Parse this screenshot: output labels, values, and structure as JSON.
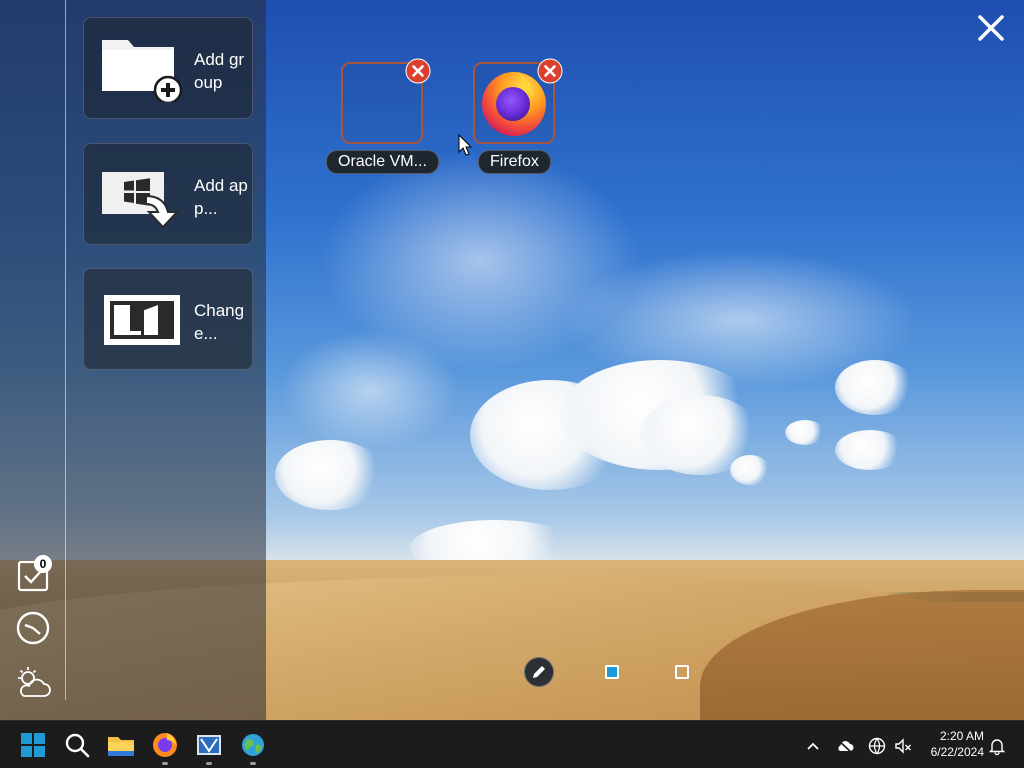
{
  "side_panel": {
    "tiles": [
      {
        "name": "add-group",
        "label": "Add group",
        "icon": "folder-plus-icon"
      },
      {
        "name": "add-app",
        "label": "Add app...",
        "icon": "windows-import-icon"
      },
      {
        "name": "change",
        "label": "Change...",
        "icon": "book-icon"
      }
    ],
    "todo_count": "0",
    "side_icons": [
      "checklist-icon",
      "clock-icon",
      "weather-icon"
    ]
  },
  "desktop_apps": [
    {
      "label": "Oracle VM...",
      "icon": "",
      "remove_icon": "remove-icon"
    },
    {
      "label": "Firefox",
      "icon": "firefox-icon",
      "remove_icon": "remove-icon"
    }
  ],
  "bottom_controls": {
    "edit_icon": "pencil-icon",
    "pages": [
      "active",
      "inactive"
    ]
  },
  "taskbar": {
    "apps": [
      "windows-start-icon",
      "search-icon",
      "file-explorer-icon",
      "firefox-icon",
      "virtualbox-icon",
      "edge-globe-icon"
    ],
    "tray": [
      "chevron-up-icon",
      "cloud-offline-icon",
      "network-icon",
      "volume-muted-icon"
    ],
    "time": "2:20 AM",
    "date": "6/22/2024",
    "notification_icon": "bell-icon"
  },
  "colors": {
    "accent": "#1e9ad6",
    "remove_red": "#d9412e",
    "frame": "#a8553d"
  }
}
